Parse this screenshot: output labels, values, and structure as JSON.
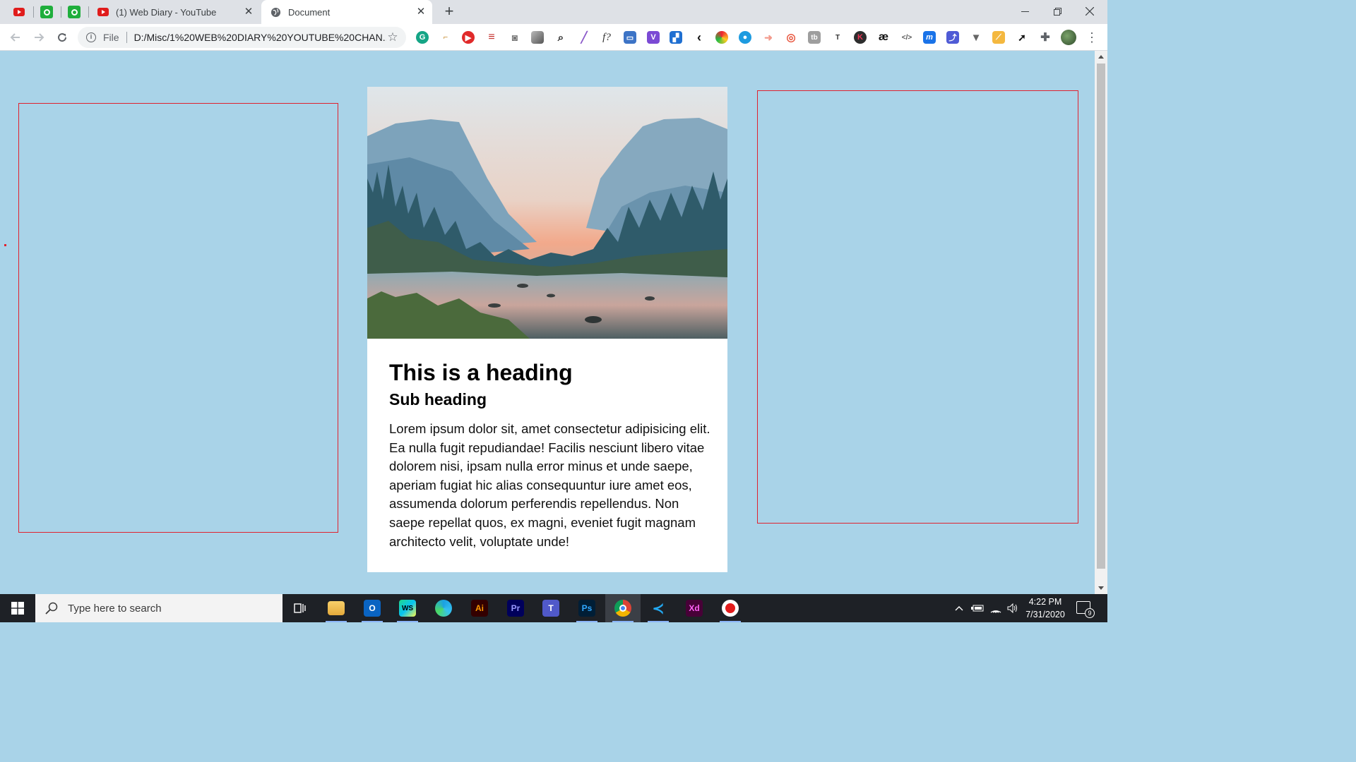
{
  "browser": {
    "pinned_tabs": [
      {
        "icon": "youtube-icon"
      },
      {
        "icon": "green-extension-icon"
      },
      {
        "icon": "green-extension-icon"
      }
    ],
    "tabs": [
      {
        "title": "(1) Web Diary - YouTube",
        "icon": "youtube-icon",
        "active": false
      },
      {
        "title": "Document",
        "icon": "globe-icon",
        "active": true
      }
    ],
    "new_tab_label": "+",
    "address": {
      "scheme_label": "File",
      "url": "D:/Misc/1%20WEB%20DIARY%20YOUTUBE%20CHAN..."
    },
    "extension_icons": [
      "grammarly-icon",
      "pin-icon",
      "play-icon",
      "lines-icon",
      "camera-icon",
      "gray-square-icon",
      "magnifier-icon",
      "pen-icon",
      "function-icon",
      "printer-icon",
      "v-icon",
      "frame-icon",
      "chevron-icon",
      "color-picker-icon",
      "blue-dot-icon",
      "arrow-icon",
      "target-icon",
      "tb-icon",
      "t-icon",
      "k-icon",
      "ae-icon",
      "code-icon",
      "m-icon",
      "chart-icon",
      "v-shape-icon",
      "ruler-icon",
      "cursor-icon",
      "puzzle-icon"
    ],
    "extension_text": {
      "function": "f?",
      "t": "T",
      "k": "K",
      "ae": "æ",
      "code": "</>",
      "m": "m"
    }
  },
  "page": {
    "card": {
      "image_alt": "mountain-valley-river-photo",
      "heading": "This is a heading",
      "subheading": "Sub heading",
      "body": "Lorem ipsum dolor sit, amet consectetur adipisicing elit. Ea nulla fugit repudiandae! Facilis nesciunt libero vitae dolorem nisi, ipsam nulla error minus et unde saepe, aperiam fugiat hic alias consequuntur iure amet eos, assumenda dolorum perferendis repellendus. Non saepe repellat quos, ex magni, eveniet fugit magnam architecto velit, voluptate unde!"
    }
  },
  "colors": {
    "page_background": "#a9d3e8",
    "box_border": "#e0212e",
    "card_background": "#ffffff"
  },
  "taskbar": {
    "search_placeholder": "Type here to search",
    "apps": [
      {
        "name": "task-view",
        "label": ""
      },
      {
        "name": "file-explorer",
        "label": ""
      },
      {
        "name": "outlook",
        "label": "O"
      },
      {
        "name": "webstorm",
        "label": "WS"
      },
      {
        "name": "edge",
        "label": ""
      },
      {
        "name": "illustrator",
        "label": "Ai"
      },
      {
        "name": "premiere",
        "label": "Pr"
      },
      {
        "name": "teams",
        "label": ""
      },
      {
        "name": "photoshop",
        "label": "Ps"
      },
      {
        "name": "chrome",
        "label": ""
      },
      {
        "name": "vscode",
        "label": ""
      },
      {
        "name": "xd",
        "label": "Xd"
      },
      {
        "name": "recorder",
        "label": ""
      }
    ],
    "time": "4:22 PM",
    "date": "7/31/2020",
    "notification_count": "9"
  }
}
